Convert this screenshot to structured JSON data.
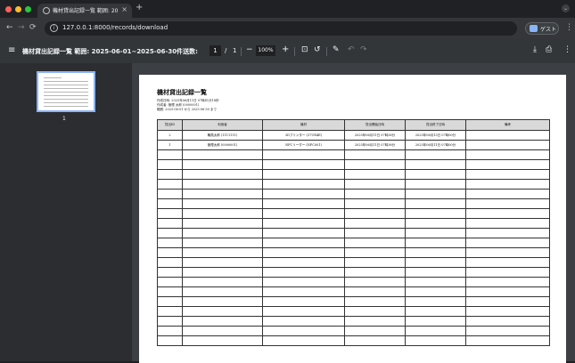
{
  "browser": {
    "tab_title": "機材貸出記録一覧 範囲: 2025-",
    "url": "127.0.0.1:8000/records/download",
    "profile_name": "ゲスト"
  },
  "pdf_toolbar": {
    "title": "機材貸出記録一覧 範囲: 2025-06-01~2025-06-30件送数: 202...",
    "page_current": "1",
    "page_separator": "/",
    "page_total": "1",
    "zoom": "100%"
  },
  "sidebar": {
    "page_number": "1"
  },
  "document": {
    "title": "機材貸出記録一覧",
    "meta_lines": [
      "作成日時: 2025年06月11日 07時41分18秒",
      "作成者: 管理 太郎 (0000001)",
      "範囲: 2025-06-01 から 2025-06-30 まで"
    ],
    "columns": [
      "貸出ID",
      "利用者",
      "機材",
      "貸出開始日時",
      "貸出終了日時",
      "備考"
    ],
    "rows": [
      [
        "2",
        "職員太郎 (1111111)",
        "3Dプリンター (37UR4E)",
        "2025年06月11日 07時38分",
        "2025年06月13日 07時00分",
        ""
      ],
      [
        "1",
        "管理太郎 (0000001)",
        "NFCリーダー (NFC001)",
        "2025年06月11日 07時38分",
        "2025年06月11日 07時00分",
        ""
      ]
    ],
    "empty_rows": 20
  }
}
